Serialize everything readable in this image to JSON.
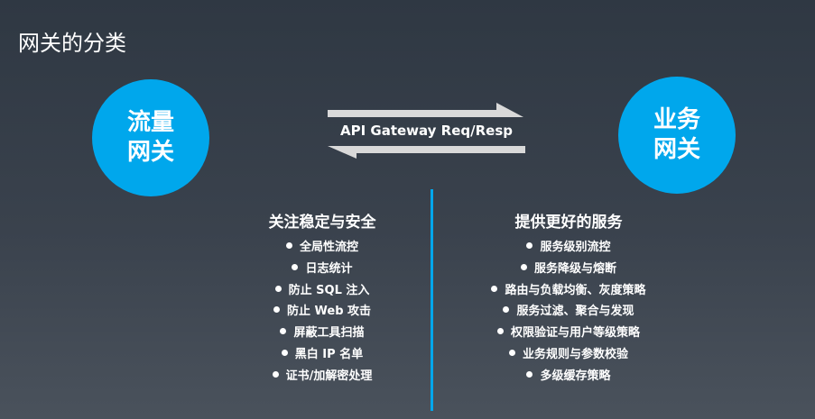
{
  "title": "网关的分类",
  "left_circle": {
    "line1": "流量",
    "line2": "网关"
  },
  "right_circle": {
    "line1": "业务",
    "line2": "网关"
  },
  "arrow_label": "API Gateway Req/Resp",
  "colors": {
    "accent": "#00a7ec",
    "arrow": "#d9d9d9"
  },
  "left_column": {
    "heading": "关注稳定与安全",
    "items": [
      "全局性流控",
      "日志统计",
      "防止 SQL 注入",
      "防止 Web 攻击",
      "屏蔽工具扫描",
      "黑白 IP 名单",
      "证书/加解密处理"
    ]
  },
  "right_column": {
    "heading": "提供更好的服务",
    "items": [
      "服务级别流控",
      "服务降级与熔断",
      "路由与负载均衡、灰度策略",
      "服务过滤、聚合与发现",
      "权限验证与用户等级策略",
      "业务规则与参数校验",
      "多级缓存策略"
    ]
  }
}
